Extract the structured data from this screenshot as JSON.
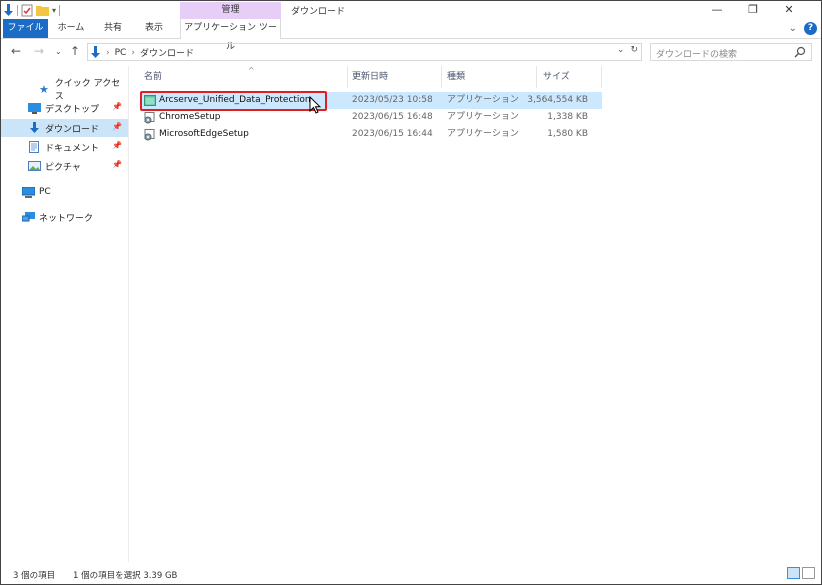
{
  "window": {
    "title": "ダウンロード",
    "context_group": "管理",
    "controls": {
      "minimize": "—",
      "maximize": "❐",
      "close": "✕"
    }
  },
  "ribbon": {
    "tabs": {
      "file": "ファイル",
      "home": "ホーム",
      "share": "共有",
      "view": "表示",
      "app_tools": "アプリケーション ツール"
    },
    "expand_glyph": "⌄",
    "help": "?"
  },
  "address": {
    "segments": [
      "PC",
      "ダウンロード"
    ],
    "separator": "›",
    "dropdown": "⌄",
    "refresh": "↻"
  },
  "search": {
    "placeholder": "ダウンロードの検索"
  },
  "navpane": {
    "quick_access": "クイック アクセス",
    "items": [
      "デスクトップ",
      "ダウンロード",
      "ドキュメント",
      "ピクチャ"
    ],
    "pc": "PC",
    "network": "ネットワーク"
  },
  "columns": {
    "name": "名前",
    "date": "更新日時",
    "type": "種類",
    "size": "サイズ"
  },
  "files": [
    {
      "name": "Arcserve_Unified_Data_Protection",
      "date": "2023/05/23 10:58",
      "type": "アプリケーション",
      "size": "3,564,554 KB",
      "selected": true
    },
    {
      "name": "ChromeSetup",
      "date": "2023/06/15 16:48",
      "type": "アプリケーション",
      "size": "1,338 KB",
      "selected": false
    },
    {
      "name": "MicrosoftEdgeSetup",
      "date": "2023/06/15 16:44",
      "type": "アプリケーション",
      "size": "1,580 KB",
      "selected": false
    }
  ],
  "status": {
    "count": "3 個の項目",
    "selection": "1 個の項目を選択  3.39 GB"
  },
  "colors": {
    "accent": "#1a6cc6",
    "context_tab": "#e7cef7",
    "selection": "#cce8ff",
    "highlight_box": "#e02020"
  }
}
